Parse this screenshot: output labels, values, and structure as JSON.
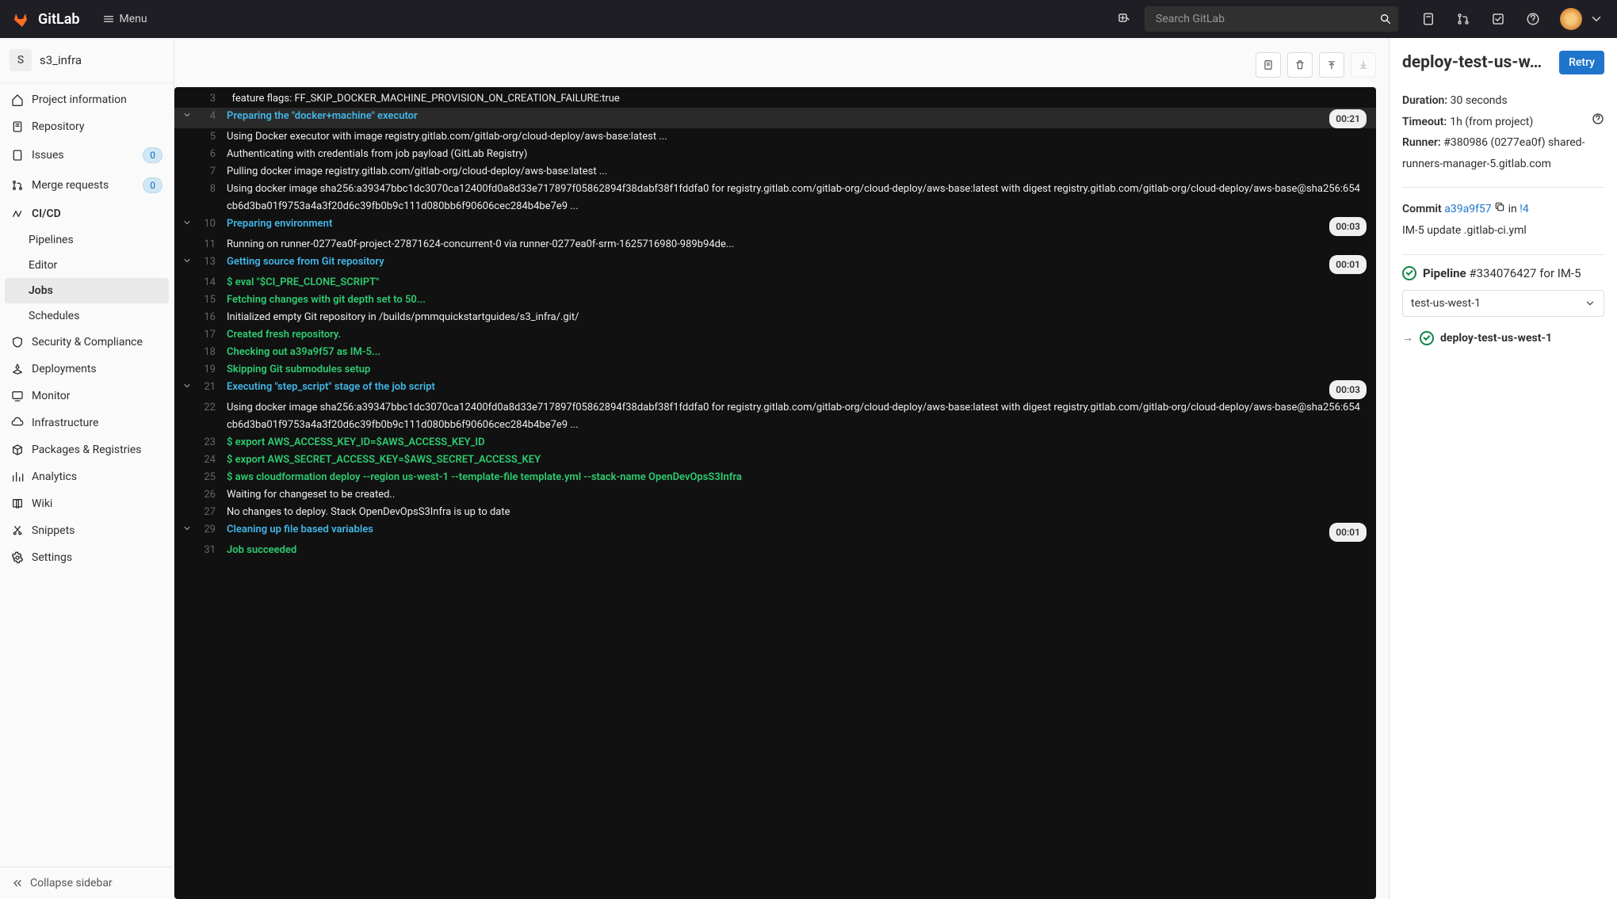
{
  "topbar": {
    "brand": "GitLab",
    "menu": "Menu",
    "search_placeholder": "Search GitLab"
  },
  "project": {
    "avatar_letter": "S",
    "name": "s3_infra"
  },
  "sidebar": {
    "items": [
      {
        "label": "Project information"
      },
      {
        "label": "Repository"
      },
      {
        "label": "Issues",
        "count": "0"
      },
      {
        "label": "Merge requests",
        "count": "0"
      },
      {
        "label": "CI/CD"
      },
      {
        "label": "Security & Compliance"
      },
      {
        "label": "Deployments"
      },
      {
        "label": "Monitor"
      },
      {
        "label": "Infrastructure"
      },
      {
        "label": "Packages & Registries"
      },
      {
        "label": "Analytics"
      },
      {
        "label": "Wiki"
      },
      {
        "label": "Snippets"
      },
      {
        "label": "Settings"
      }
    ],
    "cicd_sub": [
      {
        "label": "Pipelines"
      },
      {
        "label": "Editor"
      },
      {
        "label": "Jobs"
      },
      {
        "label": "Schedules"
      }
    ],
    "collapse": "Collapse sidebar"
  },
  "log": [
    {
      "n": "3",
      "chev": "",
      "cls": "c-white",
      "txt": "  feature flags: FF_SKIP_DOCKER_MACHINE_PROVISION_ON_CREATION_FAILURE:true"
    },
    {
      "n": "4",
      "chev": "down",
      "cls": "c-cyan",
      "sec": true,
      "txt": "Preparing the \"docker+machine\" executor",
      "time": "00:21"
    },
    {
      "n": "5",
      "chev": "",
      "cls": "c-white",
      "txt": "Using Docker executor with image registry.gitlab.com/gitlab-org/cloud-deploy/aws-base:latest ..."
    },
    {
      "n": "6",
      "chev": "",
      "cls": "c-white",
      "txt": "Authenticating with credentials from job payload (GitLab Registry)"
    },
    {
      "n": "7",
      "chev": "",
      "cls": "c-white",
      "txt": "Pulling docker image registry.gitlab.com/gitlab-org/cloud-deploy/aws-base:latest ..."
    },
    {
      "n": "8",
      "chev": "",
      "cls": "c-white",
      "txt": "Using docker image sha256:a39347bbc1dc3070ca12400fd0a8d33e717897f05862894f38dabf38f1fddfa0 for registry.gitlab.com/gitlab-org/cloud-deploy/aws-base:latest with digest registry.gitlab.com/gitlab-org/cloud-deploy/aws-base@sha256:654cb6d3ba01f9753a4a3f20d6c39fb0b9c111d080bb6f90606cec284b4be7e9 ..."
    },
    {
      "n": "10",
      "chev": "down",
      "cls": "c-cyan",
      "txt": "Preparing environment",
      "time": "00:03"
    },
    {
      "n": "11",
      "chev": "",
      "cls": "c-white",
      "txt": "Running on runner-0277ea0f-project-27871624-concurrent-0 via runner-0277ea0f-srm-1625716980-989b94de..."
    },
    {
      "n": "13",
      "chev": "down",
      "cls": "c-cyan",
      "txt": "Getting source from Git repository",
      "time": "00:01"
    },
    {
      "n": "14",
      "chev": "",
      "cls": "c-green",
      "txt": "$ eval \"$CI_PRE_CLONE_SCRIPT\""
    },
    {
      "n": "15",
      "chev": "",
      "cls": "c-green",
      "txt": "Fetching changes with git depth set to 50..."
    },
    {
      "n": "16",
      "chev": "",
      "cls": "c-white",
      "txt": "Initialized empty Git repository in /builds/pmmquickstartguides/s3_infra/.git/"
    },
    {
      "n": "17",
      "chev": "",
      "cls": "c-green",
      "txt": "Created fresh repository."
    },
    {
      "n": "18",
      "chev": "",
      "cls": "c-green",
      "txt": "Checking out a39a9f57 as IM-5..."
    },
    {
      "n": "19",
      "chev": "",
      "cls": "c-green",
      "txt": "Skipping Git submodules setup"
    },
    {
      "n": "21",
      "chev": "down",
      "cls": "c-cyan",
      "txt": "Executing \"step_script\" stage of the job script",
      "time": "00:03"
    },
    {
      "n": "22",
      "chev": "",
      "cls": "c-white",
      "txt": "Using docker image sha256:a39347bbc1dc3070ca12400fd0a8d33e717897f05862894f38dabf38f1fddfa0 for registry.gitlab.com/gitlab-org/cloud-deploy/aws-base:latest with digest registry.gitlab.com/gitlab-org/cloud-deploy/aws-base@sha256:654cb6d3ba01f9753a4a3f20d6c39fb0b9c111d080bb6f90606cec284b4be7e9 ..."
    },
    {
      "n": "23",
      "chev": "",
      "cls": "c-green",
      "txt": "$ export AWS_ACCESS_KEY_ID=$AWS_ACCESS_KEY_ID"
    },
    {
      "n": "24",
      "chev": "",
      "cls": "c-green",
      "txt": "$ export AWS_SECRET_ACCESS_KEY=$AWS_SECRET_ACCESS_KEY"
    },
    {
      "n": "25",
      "chev": "",
      "cls": "c-green",
      "txt": "$ aws cloudformation deploy --region us-west-1 --template-file template.yml --stack-name OpenDevOpsS3Infra"
    },
    {
      "n": "26",
      "chev": "",
      "cls": "c-white",
      "txt": "Waiting for changeset to be created.."
    },
    {
      "n": "27",
      "chev": "",
      "cls": "c-white",
      "txt": "No changes to deploy. Stack OpenDevOpsS3Infra is up to date"
    },
    {
      "n": "29",
      "chev": "down",
      "cls": "c-cyan",
      "txt": "Cleaning up file based variables",
      "time": "00:01"
    },
    {
      "n": "31",
      "chev": "",
      "cls": "c-green",
      "txt": "Job succeeded"
    }
  ],
  "job": {
    "title": "deploy-test-us-w…",
    "retry": "Retry",
    "duration_label": "Duration:",
    "duration_value": "30 seconds",
    "timeout_label": "Timeout:",
    "timeout_value": "1h (from project)",
    "runner_label": "Runner:",
    "runner_value": "#380986 (0277ea0f) shared-runners-manager-5.gitlab.com",
    "commit_label": "Commit",
    "commit_sha": "a39a9f57",
    "commit_in": "in",
    "commit_mr": "!4",
    "commit_msg": "IM-5 update .gitlab-ci.yml",
    "pipeline_label": "Pipeline",
    "pipeline_id": "#334076427 for IM-5",
    "stage_selected": "test-us-west-1",
    "job_name": "deploy-test-us-west-1"
  }
}
